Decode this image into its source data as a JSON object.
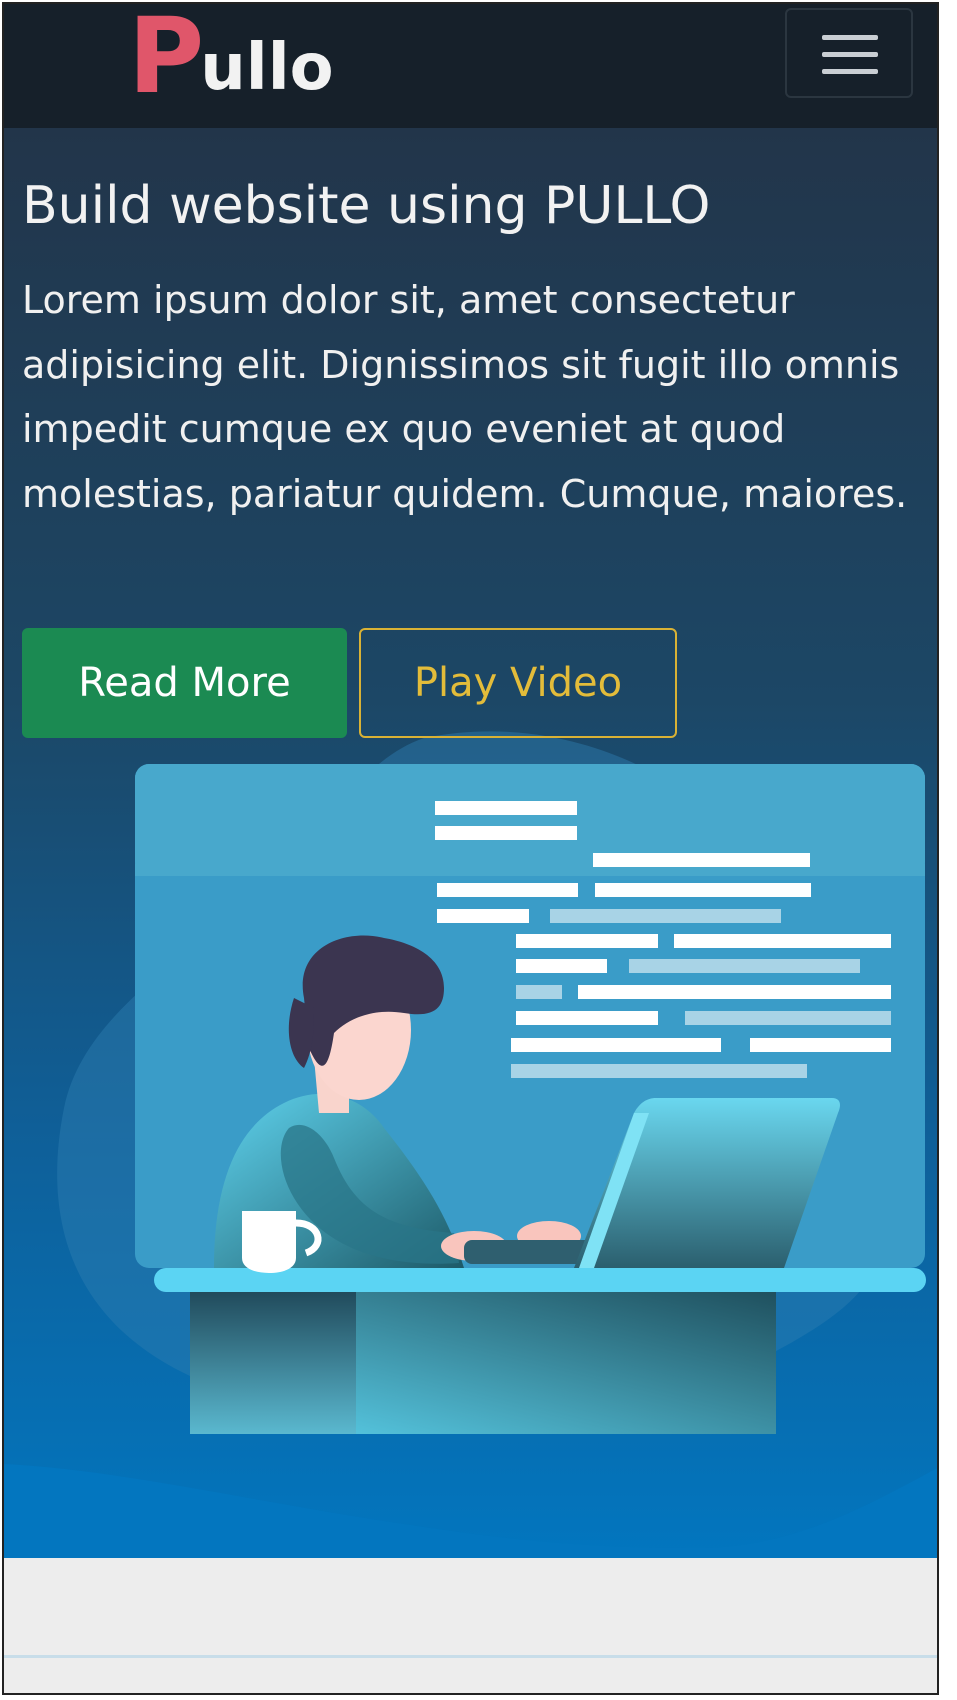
{
  "brand": {
    "logo_initial": "P",
    "logo_rest": "ullo"
  },
  "nav": {
    "menu_icon": "hamburger-menu-icon"
  },
  "hero": {
    "title": "Build website using PULLO",
    "text": "Lorem ipsum dolor sit, amet consectetur adipisicing elit. Dignissimos sit fugit illo omnis impedit cumque ex quo eveniet at quod molestias, pariatur quidem. Cumque, maiores.",
    "read_more_label": "Read More",
    "play_video_label": "Play Video",
    "illustration_icon": "developer-at-laptop-illustration"
  },
  "colors": {
    "navbar": "#16202a",
    "logo_accent": "#e0566a",
    "primary_button": "#1b8a52",
    "outline_button": "#d9b235",
    "hero_top": "#22354a",
    "hero_bottom": "#0276bf",
    "page_background": "#ededed"
  }
}
